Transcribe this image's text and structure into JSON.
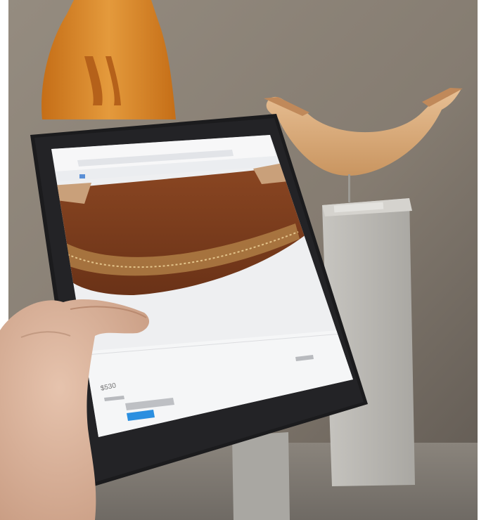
{
  "photo": {
    "subject": "hand-holding-tablet-in-museum",
    "colors": {
      "wall": "#8d8478",
      "wall_dark": "#5f5851",
      "carving_orange": "#d98a2a",
      "crescent_wood": "#d7a879",
      "pedestal": "#b8b6b1",
      "tablet_bezel": "#1b1b1d",
      "screen_bg": "#eeeff1",
      "artifact_brown": "#7a3d1e",
      "button_blue": "#2b8fe0",
      "hand_skin": "#d9b49d"
    }
  },
  "screen": {
    "price_text": "$530"
  }
}
